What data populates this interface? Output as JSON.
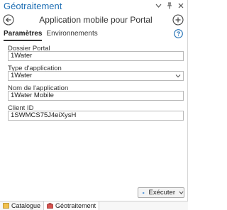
{
  "pane": {
    "title": "Géotraitement"
  },
  "titlebar_icons": [
    "chevron-down-icon",
    "pin-icon",
    "close-icon"
  ],
  "tool": {
    "title": "Application mobile pour Portal"
  },
  "tabs": [
    {
      "label": "Paramètres",
      "active": true
    },
    {
      "label": "Environnements",
      "active": false
    }
  ],
  "fields": {
    "portal_folder": {
      "label": "Dossier Portal",
      "value": "1Water"
    },
    "app_type": {
      "label": "Type d'application",
      "value": "1Water"
    },
    "app_name": {
      "label": "Nom de l'application",
      "value": "1Water Mobile"
    },
    "client_id": {
      "label": "Client ID",
      "value": "1SWMCS75J4eiXysH"
    }
  },
  "run_button": {
    "label": "Exécuter"
  },
  "bottom_tabs": [
    {
      "label": "Catalogue",
      "active": false
    },
    {
      "label": "Géotraitement",
      "active": true
    }
  ],
  "colors": {
    "accent": "#1f6fb4",
    "border": "#b9b9b9"
  }
}
